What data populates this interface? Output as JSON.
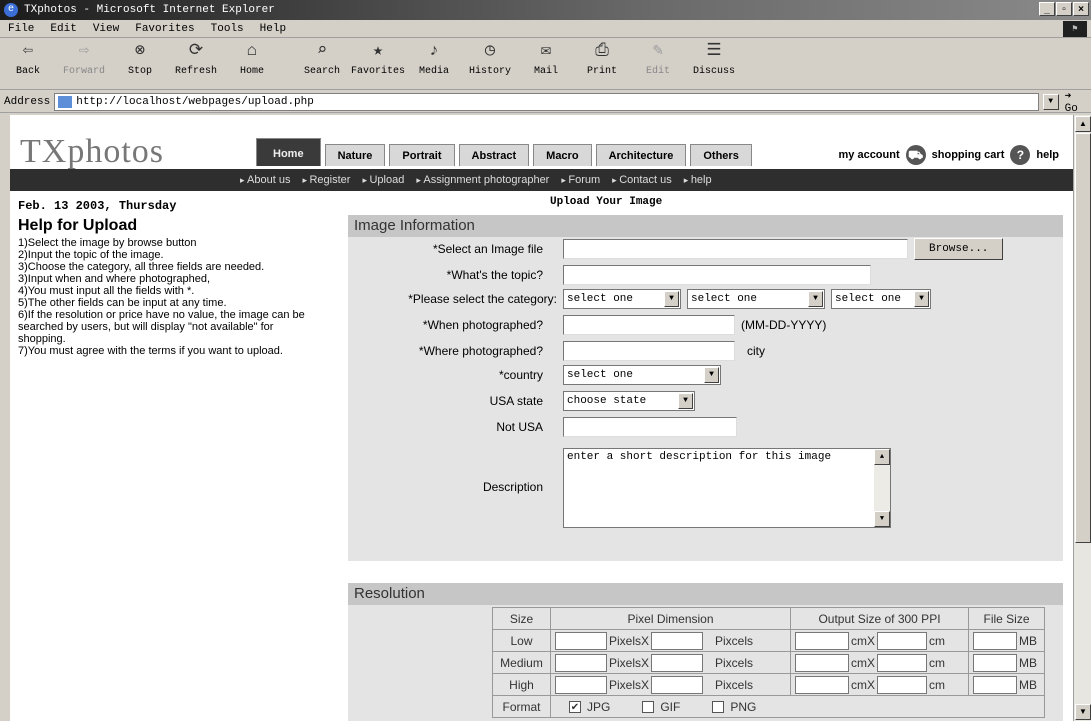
{
  "window": {
    "title": "TXphotos - Microsoft Internet Explorer",
    "controls": [
      "_",
      "▫",
      "×"
    ]
  },
  "menu": [
    "File",
    "Edit",
    "View",
    "Favorites",
    "Tools",
    "Help"
  ],
  "toolbar": [
    {
      "label": "Back",
      "icon": "⇦",
      "disabled": false
    },
    {
      "label": "Forward",
      "icon": "⇨",
      "disabled": true
    },
    {
      "label": "Stop",
      "icon": "⊗",
      "disabled": false
    },
    {
      "label": "Refresh",
      "icon": "⟳",
      "disabled": false
    },
    {
      "label": "Home",
      "icon": "⌂",
      "disabled": false
    },
    {
      "label": "Search",
      "icon": "⌕",
      "disabled": false
    },
    {
      "label": "Favorites",
      "icon": "★",
      "disabled": false
    },
    {
      "label": "Media",
      "icon": "♪",
      "disabled": false
    },
    {
      "label": "History",
      "icon": "◷",
      "disabled": false
    },
    {
      "label": "Mail",
      "icon": "✉",
      "disabled": false
    },
    {
      "label": "Print",
      "icon": "⎙",
      "disabled": false
    },
    {
      "label": "Edit",
      "icon": "✎",
      "disabled": true
    },
    {
      "label": "Discuss",
      "icon": "☰",
      "disabled": false
    }
  ],
  "address": {
    "label": "Address",
    "url": "http://localhost/webpages/upload.php",
    "go": "Go"
  },
  "site": {
    "logo": "TXphotos",
    "tabs": [
      "Home",
      "Nature",
      "Portrait",
      "Abstract",
      "Macro",
      "Architecture",
      "Others"
    ],
    "toplinks": {
      "account": "my account",
      "cart": "shopping cart",
      "help": "help"
    },
    "nav": [
      "About us",
      "Register",
      "Upload",
      "Assignment photographer",
      "Forum",
      "Contact us",
      "help"
    ],
    "date": "Feb. 13 2003, Thursday",
    "upload_title": "Upload Your Image"
  },
  "help": {
    "title": "Help for Upload",
    "lines": [
      "1)Select the image by browse button",
      "2)Input the topic of the image.",
      "3)Choose the category, all three fields are needed.",
      "3)Input when and where photographed,",
      "4)You must input all the fields with *.",
      "5)The other fields can be input at any time.",
      "6)If the resolution or price have no value, the image can be searched by users, but will display \"not available\" for shopping.",
      "7)You must agree with the terms if you want to upload."
    ]
  },
  "image_info": {
    "heading": "Image Information",
    "file_label": "*Select an Image file",
    "browse": "Browse...",
    "topic_label": "*What's the topic?",
    "category_label": "*Please select the category:",
    "category_selects": [
      "select one",
      "select one",
      "select one"
    ],
    "when_label": "*When photographed?",
    "date_hint": "(MM-DD-YYYY)",
    "where_label": "*Where photographed?",
    "city": "city",
    "country_label": "*country",
    "country_select": "select one",
    "state_label": "USA state",
    "state_select": "choose state",
    "notusa_label": "Not USA",
    "desc_label": "Description",
    "desc_value": "enter a short description for this image"
  },
  "resolution": {
    "heading": "Resolution",
    "headers": [
      "Size",
      "Pixel Dimension",
      "Output Size of 300 PPI",
      "File Size"
    ],
    "rows": [
      "Low",
      "Medium",
      "High"
    ],
    "pixels_x": "PixelsX",
    "pixcels": "Pixcels",
    "cmx": "cmX",
    "cm": "cm",
    "mb": "MB",
    "format_label": "Format",
    "formats": [
      {
        "label": "JPG",
        "checked": true
      },
      {
        "label": "GIF",
        "checked": false
      },
      {
        "label": "PNG",
        "checked": false
      }
    ]
  }
}
